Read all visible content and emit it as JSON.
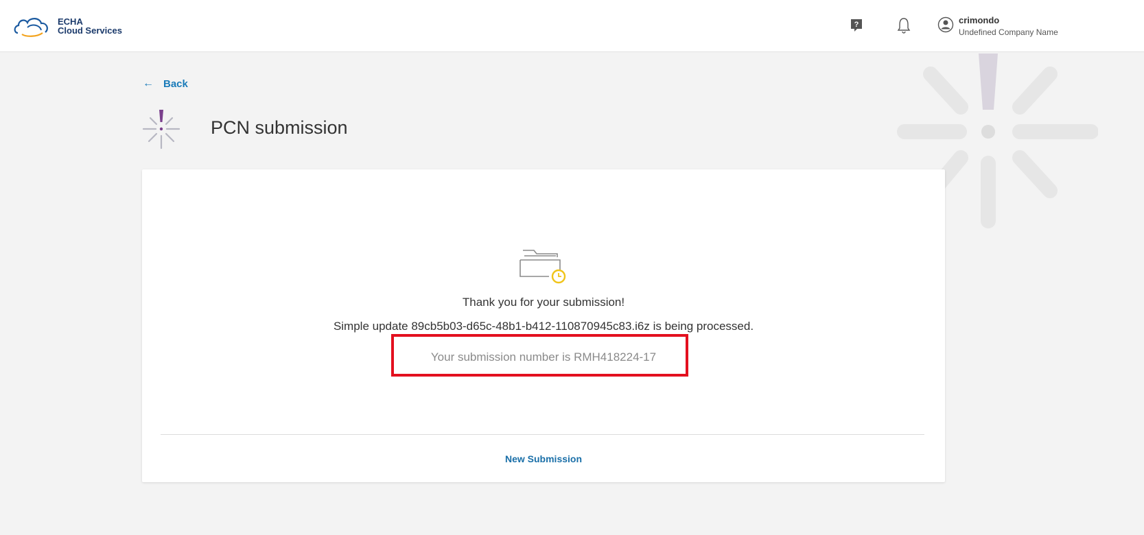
{
  "header": {
    "logo_line1": "ECHA",
    "logo_line2": "Cloud Services",
    "help_icon": "question-mark-icon",
    "notifications_icon": "bell-icon",
    "user": {
      "avatar_icon": "user-circle-icon",
      "name": "crimondo",
      "company": "Undefined Company Name"
    }
  },
  "nav": {
    "back_label": "Back",
    "back_icon": "arrow-left-icon"
  },
  "page": {
    "title": "PCN submission",
    "title_icon": "pcn-starburst-icon"
  },
  "card": {
    "status_icon": "folder-clock-icon",
    "thanks_text": "Thank you for your submission!",
    "processing_text": "Simple update 89cb5b03-d65c-48b1-b412-110870945c83.i6z is being processed.",
    "submission_number_text": "Your submission number is RMH418224-17",
    "new_submission_label": "New Submission"
  },
  "colors": {
    "accent_link": "#1a7bb9",
    "highlight_box": "#e3101f",
    "brand_purple": "#7a3f8c",
    "clock_yellow": "#f0c419"
  }
}
